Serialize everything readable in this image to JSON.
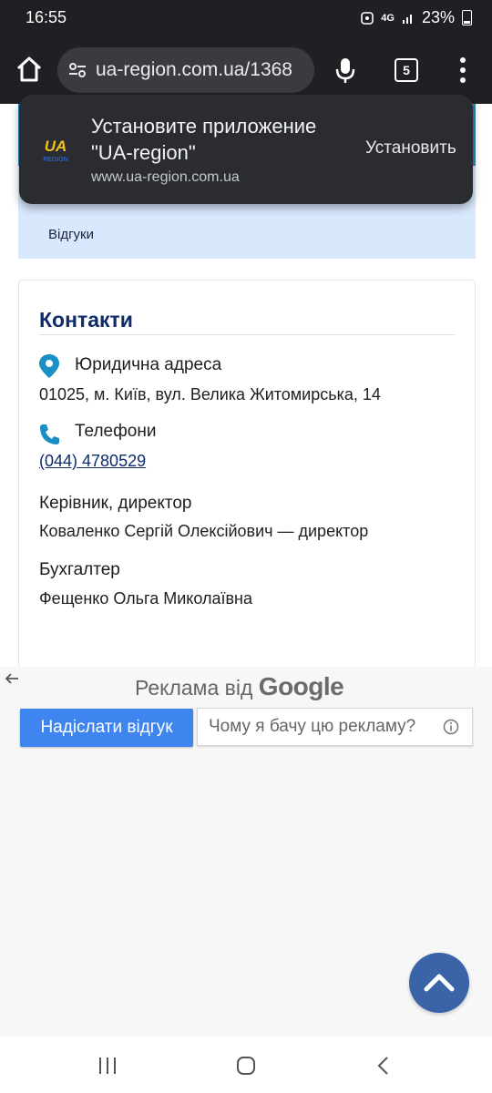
{
  "status_bar": {
    "time": "16:55",
    "network": "4G",
    "battery": "23%"
  },
  "browser": {
    "url": "ua-region.com.ua/1368",
    "tab_count": "5"
  },
  "install_banner": {
    "title": "Установите приложение \"UA-region\"",
    "url": "www.ua-region.com.ua",
    "button": "Установить",
    "logo_text_top": "UA",
    "logo_text_bottom": "REGION"
  },
  "nav": {
    "reviews_link": "Відгуки"
  },
  "contacts": {
    "title": "Контакти",
    "address_label": "Юридична адреса",
    "address_value": "01025, м. Київ, вул. Велика Житомирська, 14",
    "phones_label": "Телефони",
    "phone_value": "(044) 4780529",
    "director_label": "Керівник, директор",
    "director_value": "Коваленко Сергій Олексійович — директор",
    "accountant_label": "Бухгалтер",
    "accountant_value": "Фещенко Ольга Миколаївна"
  },
  "ad": {
    "heading_prefix": "Реклама від",
    "heading_brand": "Google",
    "send_feedback": "Надіслати відгук",
    "why_this_ad": "Чому я бачу цю рекламу?"
  },
  "colors": {
    "accent": "#0d2c6b",
    "pin": "#1a8fc5",
    "ad_button": "#3f85f0",
    "scroll_button": "#3b64a8"
  }
}
